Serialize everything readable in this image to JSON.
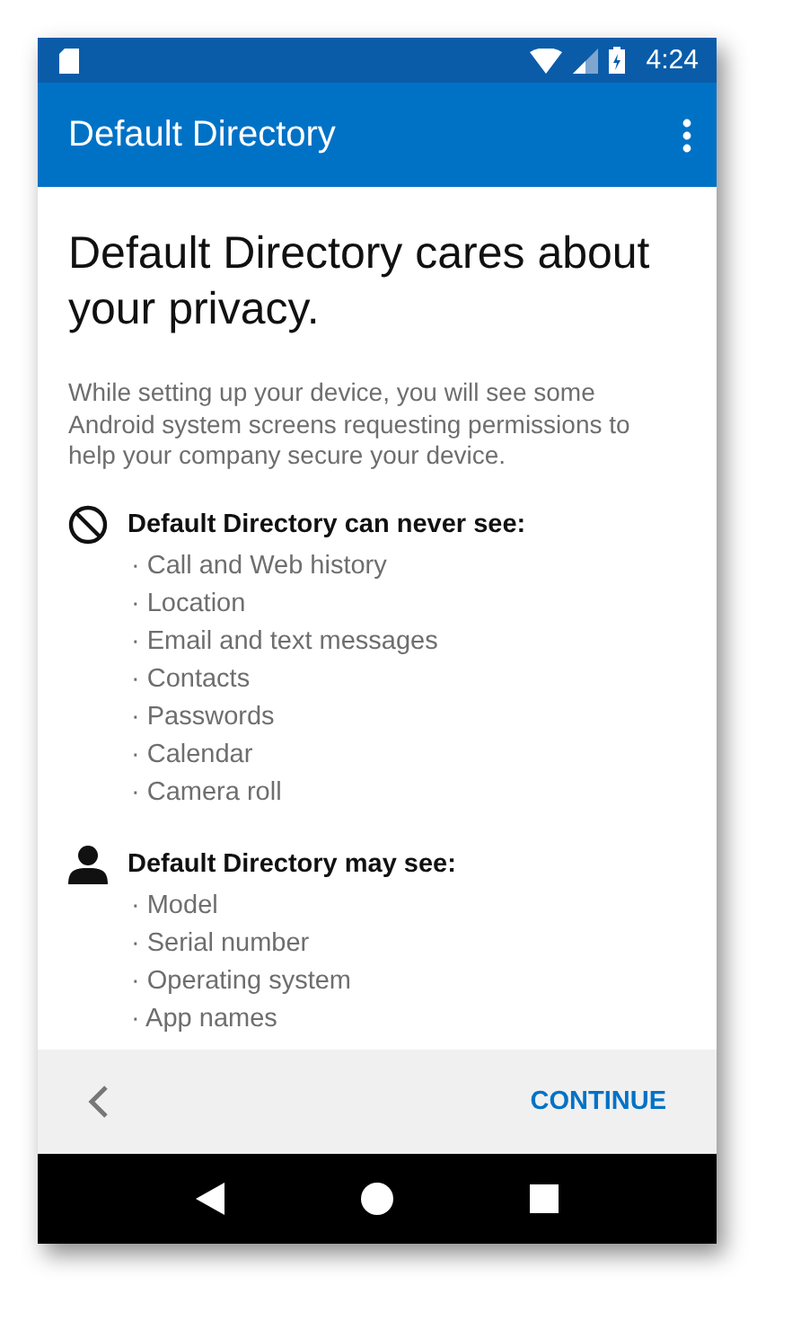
{
  "status_bar": {
    "time": "4:24"
  },
  "app_bar": {
    "title": "Default Directory"
  },
  "heading": "Default Directory cares about your privacy.",
  "intro": "While setting up your device, you will see some Android system screens requesting permissions to help your company secure your device.",
  "sections": [
    {
      "kind": "never",
      "title": "Default Directory can never see:",
      "items": [
        "· Call and Web history",
        "· Location",
        "· Email and text messages",
        "· Contacts",
        "· Passwords",
        "· Calendar",
        "· Camera roll"
      ]
    },
    {
      "kind": "may",
      "title": "Default Directory may see:",
      "items": [
        "· Model",
        "· Serial number",
        "· Operating system",
        "· App names"
      ]
    }
  ],
  "footer": {
    "continue": "CONTINUE"
  }
}
